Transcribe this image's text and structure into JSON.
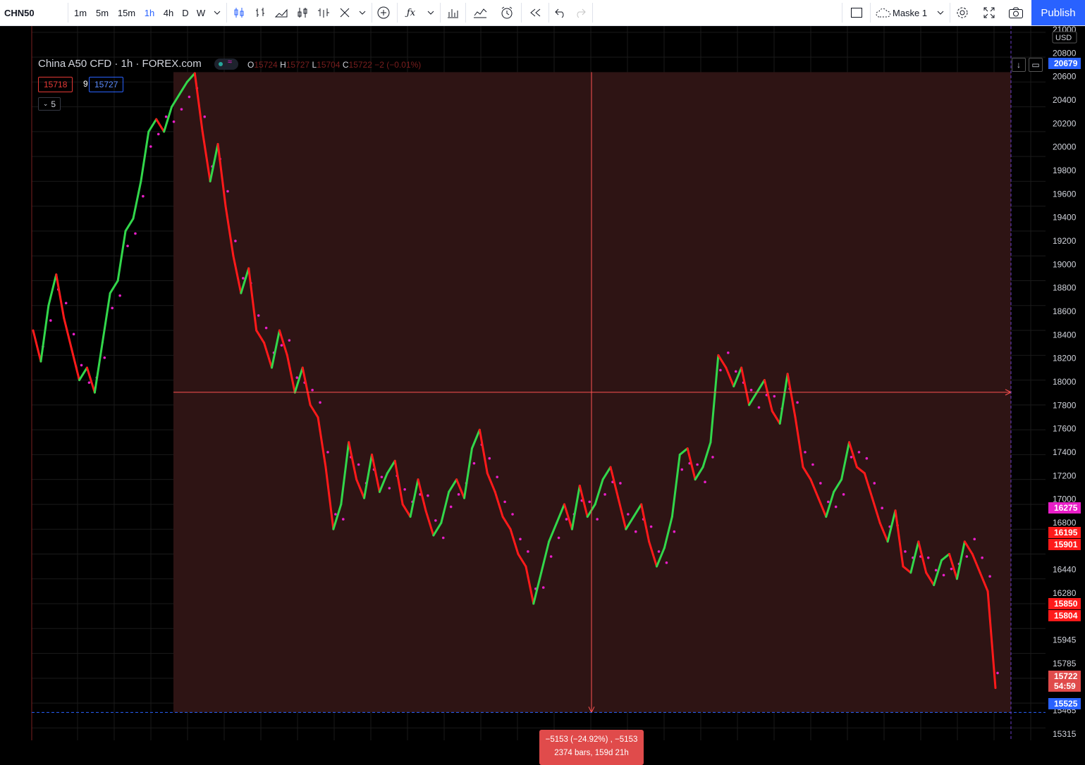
{
  "toolbar": {
    "symbol": "CHN50",
    "intervals": [
      "1m",
      "5m",
      "15m",
      "1h",
      "4h",
      "D",
      "W"
    ],
    "active_interval": "1h",
    "layout_name": "Maske 1",
    "publish_label": "Publish",
    "icons": [
      "chevron-down-icon",
      "candles-icon",
      "bars-icon",
      "area-icon",
      "hollow-candles-icon",
      "baseline-icon",
      "heikin-ashi-icon",
      "chevron-down-icon",
      "add-compare-icon",
      "indicators-icon",
      "chevron-down-icon",
      "financials-icon",
      "strategy-icon",
      "alert-icon",
      "replay-icon",
      "undo-icon",
      "redo-icon",
      "layout-square-icon",
      "cloud-icon",
      "chevron-down-icon",
      "gear-icon",
      "fullscreen-icon",
      "camera-icon"
    ]
  },
  "legend": {
    "title": "China A50 CFD · 1h · FOREX.com",
    "ohlc": {
      "o_label": "O",
      "o": "15724",
      "h_label": "H",
      "h": "15727",
      "l_label": "L",
      "l": "15704",
      "c_label": "C",
      "c": "15722",
      "change": "−2 (−0.01%)"
    },
    "bid": "15718",
    "spread": "9",
    "ask": "15727",
    "collapse_label": "5"
  },
  "price_axis": {
    "currency": "USD",
    "ticks": [
      "21000",
      "20800",
      "20600",
      "20400",
      "20200",
      "20000",
      "19800",
      "19600",
      "19400",
      "19200",
      "19000",
      "18800",
      "18600",
      "18400",
      "18200",
      "18000",
      "17800",
      "17600",
      "17400",
      "17200",
      "17000",
      "16800",
      "16600",
      "16440",
      "16280",
      "16120",
      "15945",
      "15785",
      "15625",
      "15465",
      "15315"
    ],
    "labels": [
      {
        "value": "20679",
        "color": "#2962ff"
      },
      {
        "value": "16275",
        "color": "#e91ec8"
      },
      {
        "value": "16195",
        "color": "#ff1a1a"
      },
      {
        "value": "15901",
        "color": "#ff1a1a"
      },
      {
        "value": "15850",
        "color": "#ff1a1a"
      },
      {
        "value": "15804",
        "color": "#ff1a1a"
      },
      {
        "value": "15722",
        "color": "#e04b4b"
      },
      {
        "value": "54:59",
        "color": "#e04b4b"
      },
      {
        "value": "15525",
        "color": "#2962ff"
      }
    ]
  },
  "measure": {
    "line1": "−5153 (−24.92%) , −5153",
    "line2": "2374 bars, 159d 21h",
    "start_price": 20679,
    "end_price": 15525
  },
  "colors": {
    "up": "#32d74b",
    "down": "#ff1a1a",
    "sar": "#e91ec8",
    "measure_fill": "#2e1414",
    "measure_line": "#ff5252",
    "accent": "#2962ff"
  },
  "chart_data": {
    "type": "line",
    "symbol": "China A50 CFD",
    "interval": "1h",
    "ylim": [
      15300,
      21050
    ],
    "series": [
      {
        "values": [
          18600,
          18350,
          18800,
          19050,
          18700,
          18450,
          18200,
          18300,
          18100,
          18500,
          18900,
          19000,
          19400,
          19500,
          19800,
          20200,
          20300,
          20200,
          20400,
          20500,
          20600,
          20670,
          20200,
          19800,
          20100,
          19600,
          19200,
          18900,
          19100,
          18600,
          18500,
          18300,
          18600,
          18400,
          18100,
          18300,
          18000,
          17900,
          17500,
          17000,
          17200,
          17700,
          17400,
          17250,
          17600,
          17300,
          17450,
          17550,
          17200,
          17100,
          17400,
          17150,
          16950,
          17050,
          17300,
          17400,
          17250,
          17650,
          17800,
          17450,
          17300,
          17100,
          17000,
          16800,
          16700,
          16400,
          16650,
          16900,
          17050,
          17200,
          17000,
          17350,
          17100,
          17200,
          17400,
          17500,
          17250,
          17000,
          17100,
          17200,
          16900,
          16700,
          16850,
          17100,
          17600,
          17650,
          17400,
          17500,
          17700,
          18400,
          18300,
          18150,
          18300,
          18000,
          18100,
          18200,
          17950,
          17850,
          18250,
          17900,
          17500,
          17400,
          17250,
          17100,
          17300,
          17400,
          17700,
          17500,
          17450,
          17250,
          17050,
          16900,
          17150,
          16700,
          16650,
          16900,
          16650,
          16550,
          16750,
          16800,
          16600,
          16900,
          16800,
          16650,
          16500,
          15722
        ]
      }
    ]
  }
}
